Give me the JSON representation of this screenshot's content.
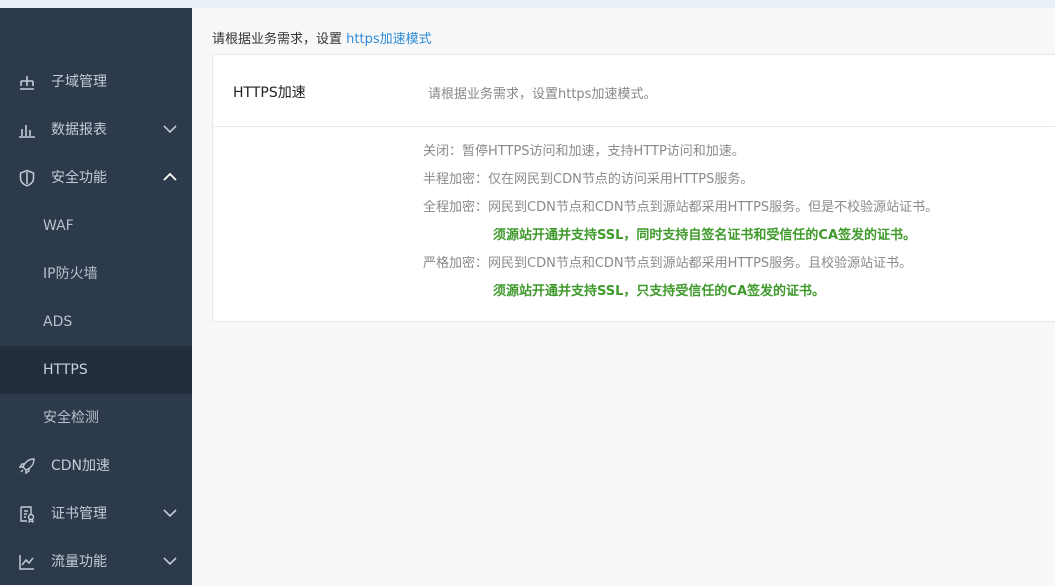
{
  "sidebar": {
    "items": [
      {
        "label": "子域管理",
        "icon": "sitemap-icon"
      },
      {
        "label": "数据报表",
        "icon": "bar-chart-icon",
        "chevron": "down"
      },
      {
        "label": "安全功能",
        "icon": "shield-icon",
        "chevron": "up"
      },
      {
        "label": "CDN加速",
        "icon": "rocket-icon"
      },
      {
        "label": "证书管理",
        "icon": "certificate-icon",
        "chevron": "down"
      },
      {
        "label": "流量功能",
        "icon": "line-chart-icon",
        "chevron": "down"
      }
    ],
    "security_subitems": [
      {
        "label": "WAF"
      },
      {
        "label": "IP防火墙"
      },
      {
        "label": "ADS"
      },
      {
        "label": "HTTPS",
        "active": true
      },
      {
        "label": "安全检测"
      }
    ]
  },
  "content": {
    "hint_prefix": "请根据业务需求，设置 ",
    "hint_link": "https加速模式",
    "setting_name": "HTTPS加速",
    "setting_desc": "请根据业务需求，设置https加速模式。",
    "modes": [
      {
        "key": "关闭：",
        "text": "暂停HTTPS访问和加速，支持HTTP访问和加速。"
      },
      {
        "key": "半程加密：",
        "text": "仅在网民到CDN节点的访问采用HTTPS服务。"
      },
      {
        "key": "全程加密：",
        "text": "网民到CDN节点和CDN节点到源站都采用HTTPS服务。但是不校验源站证书。",
        "note": "须源站开通并支持SSL，同时支持自签名证书和受信任的CA签发的证书。"
      },
      {
        "key": "严格加密：",
        "text": "网民到CDN节点和CDN节点到源站都采用HTTPS服务。且校验源站证书。",
        "note": "须源站开通并支持SSL，只支持受信任的CA签发的证书。"
      }
    ]
  },
  "colors": {
    "sidebar_bg": "#2d3a4b",
    "active_bg": "#222e3c",
    "link": "#2e8bd8",
    "note_green": "#3f9a2b"
  }
}
